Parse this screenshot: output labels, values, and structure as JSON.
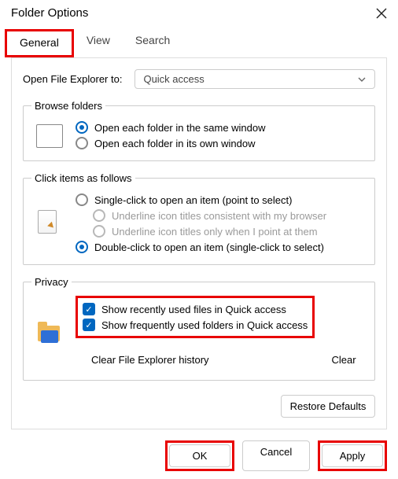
{
  "title": "Folder Options",
  "tabs": {
    "general": "General",
    "view": "View",
    "search": "Search"
  },
  "open": {
    "label": "Open File Explorer to:",
    "value": "Quick access"
  },
  "browse": {
    "legend": "Browse folders",
    "same": "Open each folder in the same window",
    "own": "Open each folder in its own window"
  },
  "click": {
    "legend": "Click items as follows",
    "single": "Single-click to open an item (point to select)",
    "under_browser": "Underline icon titles consistent with my browser",
    "under_point": "Underline icon titles only when I point at them",
    "double": "Double-click to open an item (single-click to select)"
  },
  "privacy": {
    "legend": "Privacy",
    "recent": "Show recently used files in Quick access",
    "freq": "Show frequently used folders in Quick access",
    "clear_label": "Clear File Explorer history",
    "clear_btn": "Clear"
  },
  "restore": "Restore Defaults",
  "buttons": {
    "ok": "OK",
    "cancel": "Cancel",
    "apply": "Apply"
  }
}
